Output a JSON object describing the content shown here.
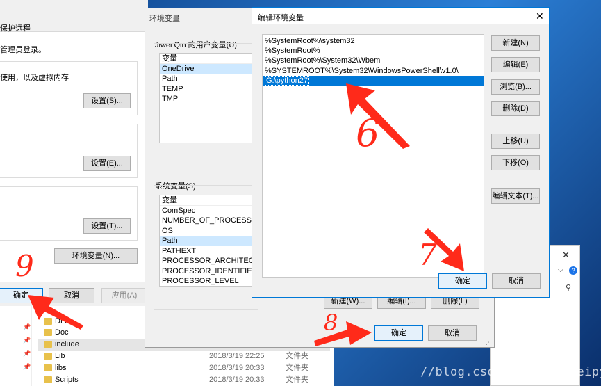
{
  "sysprops": {
    "tabs": [
      "保护",
      "远程"
    ],
    "admin_note": "管理员登录。",
    "perf_note": "使用，以及虚拟内存",
    "settings_btn_1": "设置(S)...",
    "settings_btn_2": "设置(E)...",
    "settings_btn_3": "设置(T)...",
    "envvars_btn": "环境变量(N)...",
    "ok": "确定",
    "cancel": "取消",
    "apply": "应用(A)"
  },
  "explorer": {
    "rows": [
      {
        "name": "DLLs",
        "date": "",
        "type": ""
      },
      {
        "name": "Doc",
        "date": "",
        "type": ""
      },
      {
        "name": "include",
        "date": "",
        "type": ""
      },
      {
        "name": "Lib",
        "date": "2018/3/19 22:25",
        "type": "文件夹"
      },
      {
        "name": "libs",
        "date": "2018/3/19 20:33",
        "type": "文件夹"
      },
      {
        "name": "Scripts",
        "date": "2018/3/19 20:33",
        "type": "文件夹"
      }
    ]
  },
  "envvars": {
    "title": "环境变量",
    "user_group_label": "Jiwei Qin 的用户变量(U)",
    "user_col_header": "变量",
    "user_vars": [
      "OneDrive",
      "Path",
      "TEMP",
      "TMP"
    ],
    "sys_group_label": "系统变量(S)",
    "sys_col_header": "变量",
    "sys_vars": [
      "ComSpec",
      "NUMBER_OF_PROCESSORS",
      "OS",
      "Path",
      "PATHEXT",
      "PROCESSOR_ARCHITECTU...",
      "PROCESSOR_IDENTIFIER",
      "PROCESSOR_LEVEL"
    ],
    "new_btn": "新建(W)...",
    "edit_btn": "编辑(I)...",
    "delete_btn": "删除(L)",
    "ok": "确定",
    "cancel": "取消"
  },
  "editdlg": {
    "title": "编辑环境变量",
    "close": "✕",
    "entries": [
      "%SystemRoot%\\system32",
      "%SystemRoot%",
      "%SystemRoot%\\System32\\Wbem",
      "%SYSTEMROOT%\\System32\\WindowsPowerShell\\v1.0\\",
      "G:\\python27"
    ],
    "buttons": {
      "new": "新建(N)",
      "edit": "编辑(E)",
      "browse": "浏览(B)...",
      "delete": "删除(D)",
      "move_up": "上移(U)",
      "move_down": "下移(O)",
      "edit_text": "编辑文本(T)..."
    },
    "ok": "确定",
    "cancel": "取消"
  },
  "annotations": {
    "n6": "6",
    "n7": "7",
    "n8": "8",
    "n9": "9"
  },
  "watermark": "//blog.csdn.net/qin_weipy",
  "colors": {
    "desktop": "#2b6fb6",
    "selection": "#0078d7",
    "annotation_red": "#ff2a1a"
  }
}
